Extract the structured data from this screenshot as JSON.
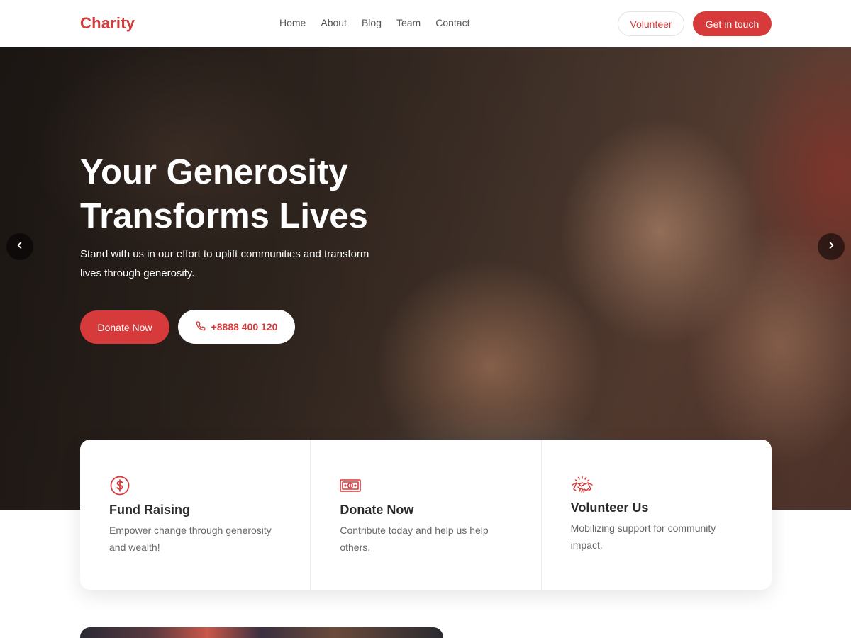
{
  "header": {
    "logo": "Charity",
    "nav": [
      "Home",
      "About",
      "Blog",
      "Team",
      "Contact"
    ],
    "volunteer_label": "Volunteer",
    "touch_label": "Get in touch"
  },
  "hero": {
    "title": "Your Generosity Transforms Lives",
    "subtitle": "Stand with us in our effort to uplift communities and transform lives through generosity.",
    "donate_label": "Donate Now",
    "phone_label": "+8888 400 120",
    "prev_icon": "chevron-left-icon",
    "next_icon": "chevron-right-icon"
  },
  "cards": [
    {
      "icon": "dollar-circle-icon",
      "title": "Fund Raising",
      "desc": "Empower change through generosity and wealth!"
    },
    {
      "icon": "banknote-icon",
      "title": "Donate Now",
      "desc": "Contribute today and help us help others."
    },
    {
      "icon": "handshake-icon",
      "title": "Volunteer Us",
      "desc": "Mobilizing support for community impact."
    }
  ],
  "colors": {
    "accent": "#d63a3a",
    "text": "#2b2b2b",
    "muted": "#666666"
  }
}
